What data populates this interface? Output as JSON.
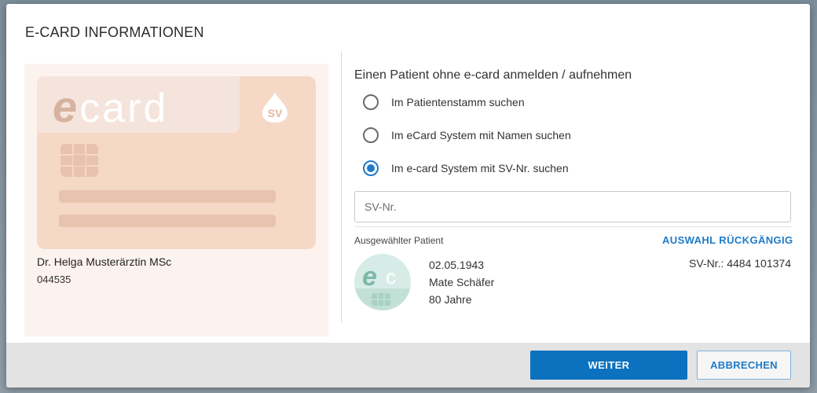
{
  "dialog": {
    "title": "E-CARD INFORMATIONEN"
  },
  "card": {
    "logo_e": "e",
    "logo_rest": "card",
    "badge": "SV",
    "holder_name": "Dr. Helga Musterärztin MSc",
    "holder_number": "044535"
  },
  "options": {
    "heading": "Einen Patient ohne e-card anmelden / aufnehmen",
    "items": [
      {
        "label": "Im Patientenstamm suchen",
        "checked": false
      },
      {
        "label": "Im eCard System mit Namen suchen",
        "checked": false
      },
      {
        "label": "Im e-card System mit SV-Nr. suchen",
        "checked": true
      }
    ]
  },
  "sv_input": {
    "placeholder": "SV-Nr.",
    "value": ""
  },
  "selected_patient": {
    "label": "Ausgewählter Patient",
    "undo_label": "AUSWAHL RÜCKGÄNGIG",
    "birth_date": "02.05.1943",
    "name": "Mate Schäfer",
    "age": "80 Jahre",
    "svnr": "SV-Nr.: 4484 101374",
    "avatar_text": "ec"
  },
  "footer": {
    "primary_label": "WEITER",
    "secondary_label": "ABBRECHEN"
  },
  "colors": {
    "accent": "#0c71bf",
    "link": "#1f7bc8",
    "card_bg": "#f5d8c6",
    "panel_bg": "#fdf3ee"
  }
}
